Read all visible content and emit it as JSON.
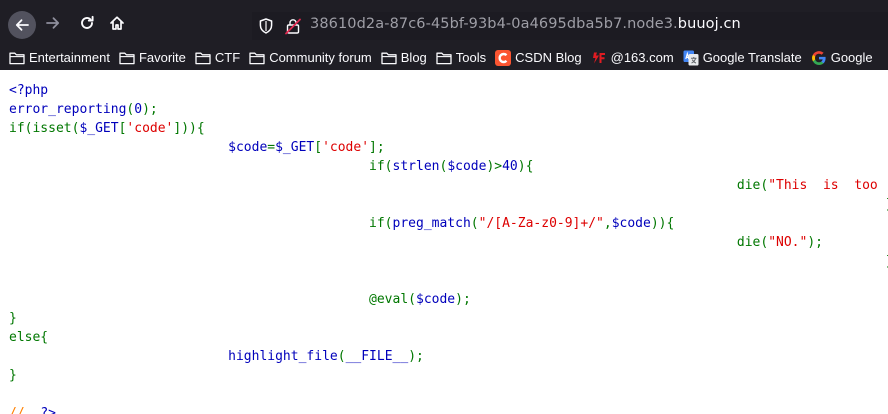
{
  "browser": {
    "url_path": "38610d2a-87c6-45bf-93b4-0a4695dba5b7.node3.",
    "url_host": "buuoj.cn"
  },
  "bookmarks": [
    {
      "label": "Entertainment",
      "icon": "folder-icon"
    },
    {
      "label": "Favorite",
      "icon": "folder-icon"
    },
    {
      "label": "CTF",
      "icon": "folder-icon"
    },
    {
      "label": "Community forum",
      "icon": "folder-icon"
    },
    {
      "label": "Blog",
      "icon": "folder-icon"
    },
    {
      "label": "Tools",
      "icon": "folder-icon"
    },
    {
      "label": "CSDN Blog",
      "icon": "csdn-logo-icon",
      "color": "#fc5531"
    },
    {
      "label": "@163.com",
      "icon": "netease-logo-icon",
      "color": "#e11c22"
    },
    {
      "label": "Google Translate",
      "icon": "google-translate-icon",
      "color": "#4285f4"
    },
    {
      "label": "Google",
      "icon": "google-logo-icon"
    }
  ],
  "syntax_colors": {
    "default": "#0000bb",
    "keyword": "#007700",
    "string": "#dd0000",
    "comment": "#ff8000"
  },
  "code_lines": [
    [
      {
        "t": "default",
        "v": "<?php"
      }
    ],
    [
      {
        "t": "default",
        "v": "error_reporting"
      },
      {
        "t": "keyword",
        "v": "("
      },
      {
        "t": "default",
        "v": "0"
      },
      {
        "t": "keyword",
        "v": ");"
      }
    ],
    [
      {
        "t": "keyword",
        "v": "if(isset("
      },
      {
        "t": "default",
        "v": "$_GET"
      },
      {
        "t": "keyword",
        "v": "["
      },
      {
        "t": "string",
        "v": "'code'"
      },
      {
        "t": "keyword",
        "v": "])){"
      }
    ],
    [
      {
        "t": "default",
        "v": "                            $code"
      },
      {
        "t": "keyword",
        "v": "="
      },
      {
        "t": "default",
        "v": "$_GET"
      },
      {
        "t": "keyword",
        "v": "["
      },
      {
        "t": "string",
        "v": "'code'"
      },
      {
        "t": "keyword",
        "v": "];"
      }
    ],
    [
      {
        "t": "default",
        "v": "                                              "
      },
      {
        "t": "keyword",
        "v": "if("
      },
      {
        "t": "default",
        "v": "strlen"
      },
      {
        "t": "keyword",
        "v": "("
      },
      {
        "t": "default",
        "v": "$code"
      },
      {
        "t": "keyword",
        "v": ")>"
      },
      {
        "t": "default",
        "v": "40"
      },
      {
        "t": "keyword",
        "v": "){"
      }
    ],
    [
      {
        "t": "keyword",
        "v": "                                                                                             die("
      },
      {
        "t": "string",
        "v": "\"This  is  too  Long.\""
      },
      {
        "t": "keyword",
        "v": ");"
      }
    ],
    [
      {
        "t": "keyword",
        "v": "                                                                                                                }"
      }
    ],
    [
      {
        "t": "default",
        "v": "                                              "
      },
      {
        "t": "keyword",
        "v": "if("
      },
      {
        "t": "default",
        "v": "preg_match"
      },
      {
        "t": "keyword",
        "v": "("
      },
      {
        "t": "string",
        "v": "\"/[A-Za-z0-9]+/\""
      },
      {
        "t": "keyword",
        "v": ","
      },
      {
        "t": "default",
        "v": "$code"
      },
      {
        "t": "keyword",
        "v": ")){"
      }
    ],
    [
      {
        "t": "keyword",
        "v": "                                                                                             die("
      },
      {
        "t": "string",
        "v": "\"NO.\""
      },
      {
        "t": "keyword",
        "v": ");"
      }
    ],
    [
      {
        "t": "keyword",
        "v": "                                                                                                                }"
      }
    ],
    [
      {
        "t": "keyword",
        "v": " "
      }
    ],
    [
      {
        "t": "keyword",
        "v": "                                              @eval("
      },
      {
        "t": "default",
        "v": "$code"
      },
      {
        "t": "keyword",
        "v": ");"
      }
    ],
    [
      {
        "t": "keyword",
        "v": "}"
      }
    ],
    [
      {
        "t": "keyword",
        "v": "else{"
      }
    ],
    [
      {
        "t": "default",
        "v": "                            highlight_file"
      },
      {
        "t": "keyword",
        "v": "("
      },
      {
        "t": "default",
        "v": "__FILE__"
      },
      {
        "t": "keyword",
        "v": ");"
      }
    ],
    [
      {
        "t": "keyword",
        "v": "}"
      }
    ],
    [
      {
        "t": "keyword",
        "v": " "
      }
    ],
    [
      {
        "t": "comment",
        "v": "//  "
      },
      {
        "t": "default",
        "v": "?>"
      }
    ]
  ]
}
